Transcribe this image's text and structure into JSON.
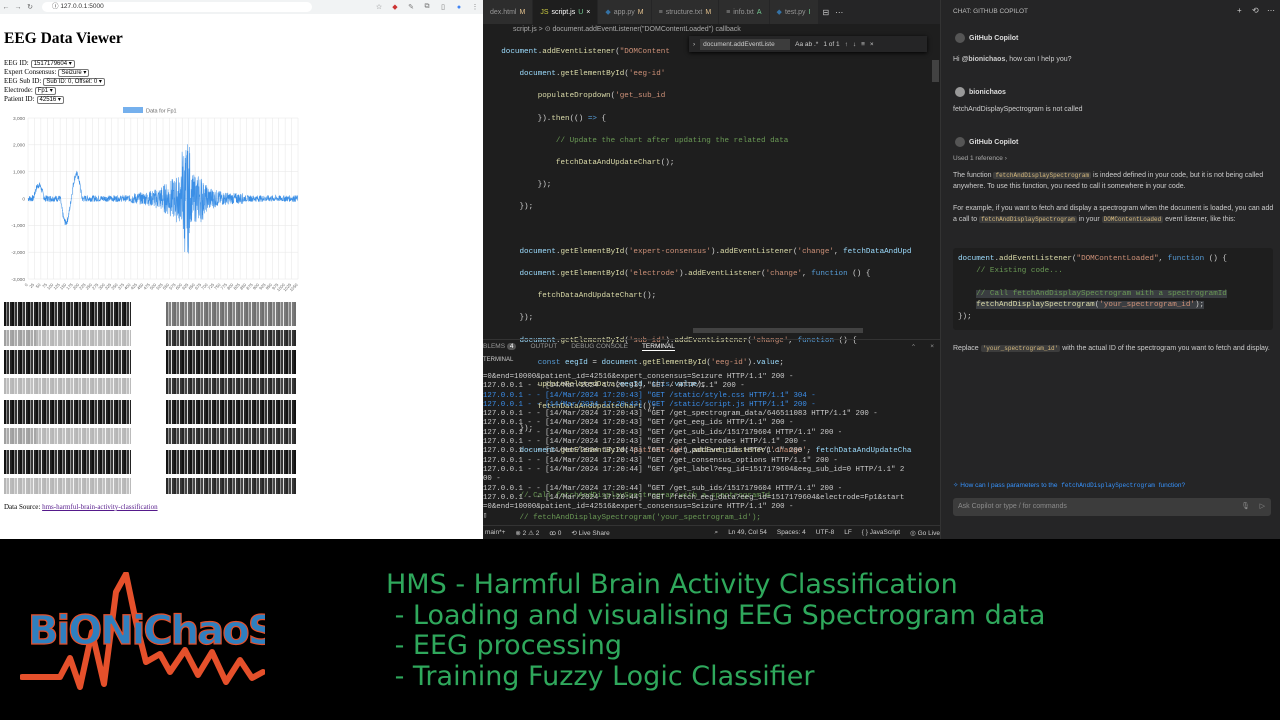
{
  "browser": {
    "url": "127.0.0.1:5000",
    "title": "EEG Data Viewer",
    "fields": [
      {
        "label": "EEG ID:",
        "value": "1517179604"
      },
      {
        "label": "Expert Consensus:",
        "value": "Seizure"
      },
      {
        "label": "EEG Sub ID:",
        "value": "Sub ID: 0, Offset: 0"
      },
      {
        "label": "Electrode:",
        "value": "Fp1"
      },
      {
        "label": "Patient ID:",
        "value": "42516"
      }
    ],
    "datasource_label": "Data Source:",
    "datasource_link": "hms-harmful-brain-activity-classification"
  },
  "chart_data": {
    "type": "line",
    "legend": "Data for Fp1",
    "ylim": [
      -3000,
      3000
    ],
    "yticks": [
      "3,000",
      "2,000",
      "1,000",
      "0",
      "-1,000",
      "-2,000",
      "-3,000"
    ],
    "xticks": [
      "0",
      "25",
      "50",
      "75",
      "100",
      "125",
      "150",
      "175",
      "200",
      "225",
      "250",
      "275",
      "300",
      "325",
      "350",
      "375",
      "400",
      "425",
      "450",
      "475",
      "500",
      "525",
      "550",
      "575",
      "600",
      "625",
      "650",
      "675",
      "700",
      "725",
      "750",
      "775",
      "800",
      "825",
      "850",
      "875",
      "900",
      "925",
      "950",
      "975",
      "1000",
      "1025",
      "1050"
    ],
    "series": [
      {
        "name": "Data for Fp1",
        "color": "#3b8fe6"
      }
    ]
  },
  "vscode": {
    "tabs": [
      {
        "label": "dex.html",
        "flag": "M"
      },
      {
        "label": "script.js",
        "flag": "U",
        "active": true
      },
      {
        "label": "app.py",
        "flag": "M"
      },
      {
        "label": "structure.txt",
        "flag": "M"
      },
      {
        "label": "info.txt",
        "flag": "A"
      },
      {
        "label": "test.py",
        "flag": "I"
      }
    ],
    "breadcrumb": "script.js > ⊙ document.addEventListener(\"DOMContentLoaded\") callback",
    "find_text": "document.addEventListe",
    "find_options": "Aa  ab  .*",
    "find_count": "1 of 1",
    "panel_tabs": [
      "BLEMS",
      "4",
      "OUTPUT",
      "DEBUG CONSOLE",
      "TERMINAL"
    ],
    "terminal_header": "TERMINAL",
    "terminal_lines": [
      "=0&end=10000&patient_id=42516&expert_consensus=Seizure HTTP/1.1\" 200 -",
      "127.0.0.1 - - [14/Mar/2024 17:20:43] \"GET / HTTP/1.1\" 200 -",
      "127.0.0.1 - - [14/Mar/2024 17:20:43] \"GET /static/style.css HTTP/1.1\" 304 -",
      "127.0.0.1 - - [14/Mar/2024 17:20:43] \"GET /static/script.js HTTP/1.1\" 200 -",
      "127.0.0.1 - - [14/Mar/2024 17:20:43] \"GET /get_spectrogram_data/646511083 HTTP/1.1\" 200 -",
      "127.0.0.1 - - [14/Mar/2024 17:20:43] \"GET /get_eeg_ids HTTP/1.1\" 200 -",
      "127.0.0.1 - - [14/Mar/2024 17:20:43] \"GET /get_sub_ids/1517179604 HTTP/1.1\" 200 -",
      "127.0.0.1 - - [14/Mar/2024 17:20:43] \"GET /get_electrodes HTTP/1.1\" 200 -",
      "127.0.0.1 - - [14/Mar/2024 17:20:43] \"GET /get_patient_ids HTTP/1.1\" 200 -",
      "127.0.0.1 - - [14/Mar/2024 17:20:43] \"GET /get_consensus_options HTTP/1.1\" 200 -",
      "127.0.0.1 - - [14/Mar/2024 17:20:44] \"GET /get_label?eeg_id=1517179604&eeg_sub_id=0 HTTP/1.1\" 2",
      "00 -",
      "127.0.0.1 - - [14/Mar/2024 17:20:44] \"GET /get_sub_ids/1517179604 HTTP/1.1\" 200 -",
      "127.0.0.1 - - [14/Mar/2024 17:20:44] \"GET /fetch_eeg_data?eeg_id=1517179604&electrode=Fp1&start",
      "=0&end=10000&patient_id=42516&expert_consensus=Seizure HTTP/1.1\" 200 -",
      "▯"
    ],
    "status": {
      "branch": "main*+",
      "sync": "⊗ 2 ⚠ 2",
      "ports": "ꝏ 0",
      "live": "⟲ Live Share",
      "position": "Ln 49, Col 54",
      "spaces": "Spaces: 4",
      "eol": "LF",
      "encoding": "UTF-8",
      "lang": "{ } JavaScript",
      "golive": "◎ Go Live"
    }
  },
  "copilot": {
    "header": "CHAT: GITHUB COPILOT",
    "assistant_name": "GitHub Copilot",
    "greeting_prefix": "Hi ",
    "greeting_user": "@bionichaos",
    "greeting_suffix": ", how can I help you?",
    "user_name": "bionichaos",
    "user_message": "fetchAndDisplaySpectrogram is not called",
    "used_refs": "Used 1 reference",
    "p1_a": "The function ",
    "p1_code": "fetchAndDisplaySpectrogram",
    "p1_b": " is indeed defined in your code, but it is not being called anywhere. To use this function, you need to call it somewhere in your code.",
    "p2_a": "For example, if you want to fetch and display a spectrogram when the document is loaded, you can add a call to ",
    "p2_code": "fetchAndDisplaySpectrogram",
    "p2_b": " in your ",
    "p2_code2": "DOMContentLoaded",
    "p2_c": " event listener, like this:",
    "p3_a": "Replace ",
    "p3_code": "'your_spectrogram_id'",
    "p3_b": " with the actual ID of the spectrogram you want to fetch and display.",
    "followup_a": "How can I pass parameters to the ",
    "followup_code": "fetchAndDisplaySpectrogram",
    "followup_b": " function?",
    "input_placeholder": "Ask Copilot or type / for commands"
  },
  "banner": {
    "logo_text": "BiONiChaoS",
    "lines": [
      "HMS - Harmful Brain Activity Classification",
      " - Loading and visualising EEG Spectrogram data",
      " - EEG processing",
      " - Training Fuzzy Logic Classifier"
    ],
    "text_color": "#2fa85c"
  }
}
